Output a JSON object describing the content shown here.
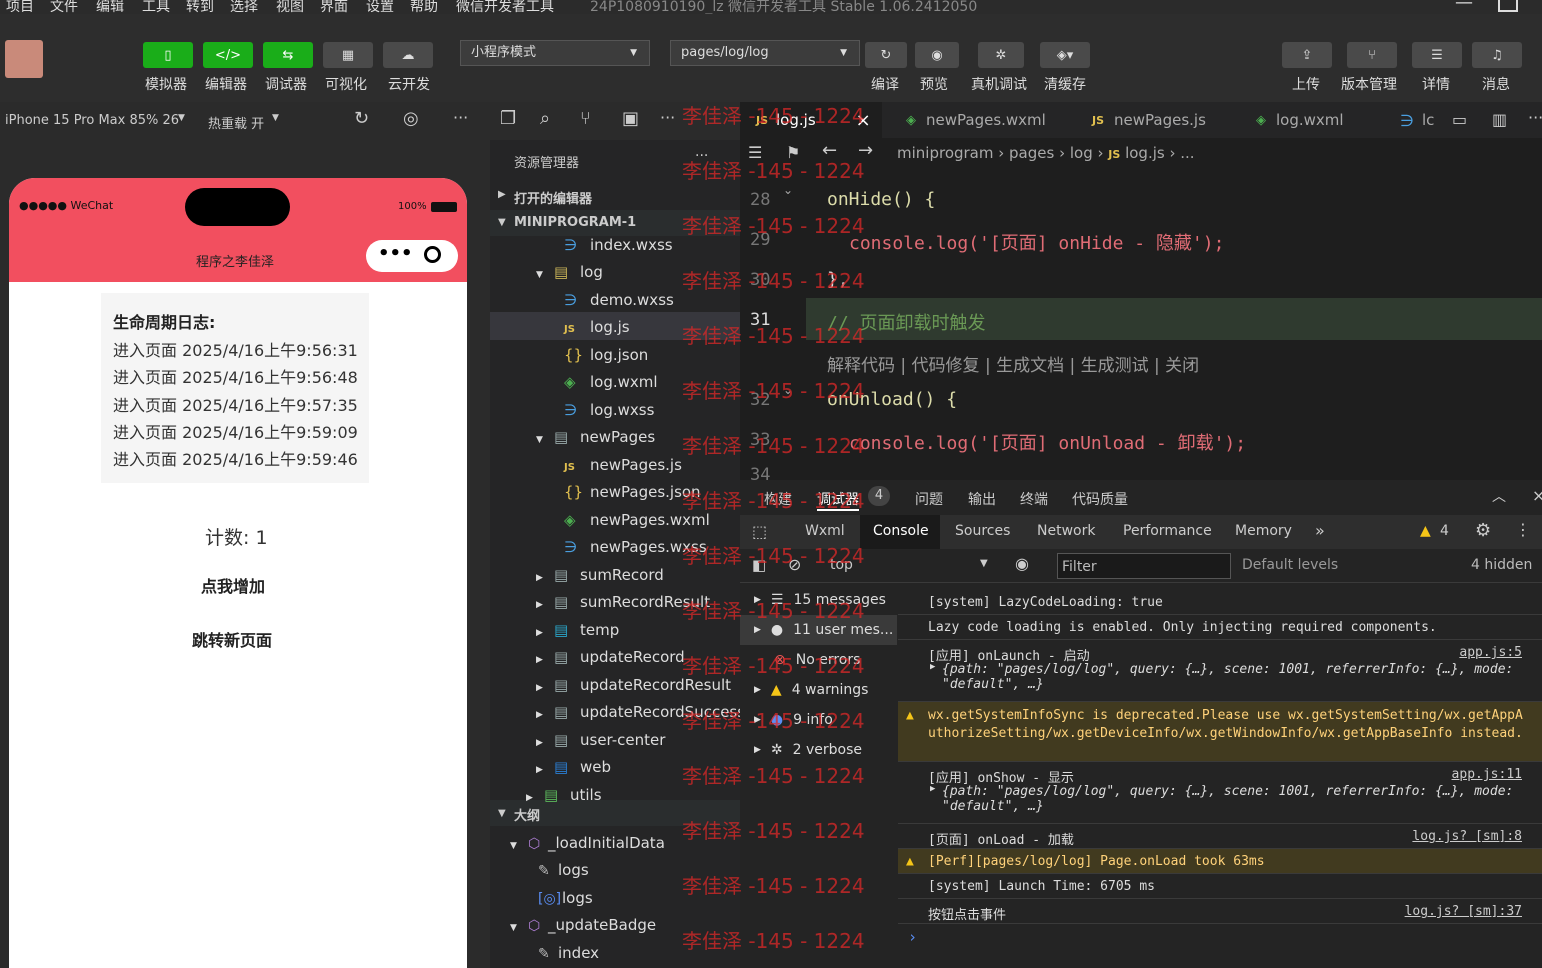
{
  "menu": [
    "项目",
    "文件",
    "编辑",
    "工具",
    "转到",
    "选择",
    "视图",
    "界面",
    "设置",
    "帮助",
    "微信开发者工具"
  ],
  "window_title": "24P1080910190_lz 微信开发者工具 Stable 1.06.2412050",
  "toolbar": {
    "simulator": "模拟器",
    "editor": "编辑器",
    "debugger": "调试器",
    "visual": "可视化",
    "cloud": "云开发",
    "mode": "小程序模式",
    "page_path": "pages/log/log",
    "compile": "编译",
    "preview": "预览",
    "real_debug": "真机调试",
    "clear_cache": "清缓存",
    "upload": "上传",
    "version": "版本管理",
    "details": "详情",
    "messages": "消息"
  },
  "subbar": {
    "device": "iPhone 15 Pro Max 85% 26",
    "hot_reload": "热重载 开"
  },
  "phone": {
    "carrier": "●●●●● WeChat",
    "battery": "100%",
    "title": "程序之李佳泽",
    "log_title": "生命周期日志:",
    "logs": [
      "进入页面 2025/4/16上午9:56:31",
      "进入页面 2025/4/16上午9:56:48",
      "进入页面 2025/4/16上午9:57:35",
      "进入页面 2025/4/16上午9:59:09",
      "进入页面 2025/4/16上午9:59:46"
    ],
    "count": "计数: 1",
    "add_btn": "点我增加",
    "nav_btn": "跳转新页面"
  },
  "explorer": {
    "title": "资源管理器",
    "open_editors": "打开的编辑器",
    "project": "MINIPROGRAM-1",
    "items": [
      "index.wxss",
      "log",
      "demo.wxss",
      "log.js",
      "log.json",
      "log.wxml",
      "log.wxss",
      "newPages",
      "newPages.js",
      "newPages.json",
      "newPages.wxml",
      "newPages.wxss",
      "sumRecord",
      "sumRecordResult",
      "temp",
      "updateRecord",
      "updateRecordResult",
      "updateRecordSuccess",
      "user-center",
      "web",
      "utils"
    ],
    "outline": "大纲",
    "outline_items": [
      "_loadInitialData",
      "logs",
      "logs",
      "_updateBadge",
      "index"
    ]
  },
  "tabs": [
    "log.js",
    "newPages.wxml",
    "newPages.js",
    "log.wxml",
    "lc"
  ],
  "breadcrumb": [
    "miniprogram",
    "pages",
    "log",
    "log.js",
    "..."
  ],
  "code": {
    "line_numbers": [
      "28",
      "29",
      "30",
      "31",
      "32",
      "33",
      "34"
    ],
    "l28": "onHide() {",
    "l29": "console.log('[页面] onHide - 隐藏');",
    "l30": "},",
    "l31": "// 页面卸载时触发",
    "actions": "解释代码 | 代码修复 | 生成文档 | 生成测试 | 关闭",
    "l32": "onUnload() {",
    "l33": "console.log('[页面] onUnload - 卸载');"
  },
  "devtools": {
    "top_tabs": [
      "构建",
      "调试器",
      "问题",
      "输出",
      "终端",
      "代码质量"
    ],
    "debugger_badge": "4",
    "panel_tabs": [
      "Wxml",
      "Console",
      "Sources",
      "Network",
      "Performance",
      "Memory"
    ],
    "warn_count": "4",
    "context": "top",
    "filter_placeholder": "Filter",
    "levels": "Default levels",
    "hidden": "4 hidden",
    "sidebar": [
      "15 messages",
      "11 user mes...",
      "No errors",
      "4 warnings",
      "9 info",
      "2 verbose"
    ]
  },
  "console": [
    {
      "text": "[system] LazyCodeLoading: true"
    },
    {
      "text": "Lazy code loading is enabled. Only injecting required components."
    },
    {
      "text": "[应用] onLaunch - 启动",
      "link": "app.js:5",
      "sub": "{path: \"pages/log/log\", query: {…}, scene: 1001, referrerInfo: {…}, mode: \"default\", …}"
    },
    {
      "text": "wx.getSystemInfoSync is deprecated.Please use wx.getSystemSetting/wx.getAppAuthorizeSetting/wx.getDeviceInfo/wx.getWindowInfo/wx.getAppBaseInfo instead.",
      "warn": true
    },
    {
      "text": "[应用] onShow - 显示",
      "link": "app.js:11",
      "sub": "{path: \"pages/log/log\", query: {…}, scene: 1001, referrerInfo: {…}, mode: \"default\", …}"
    },
    {
      "text": "[页面] onLoad - 加载",
      "link": "log.js? [sm]:8"
    },
    {
      "text": "[Perf][pages/log/log] Page.onLoad took 63ms",
      "warn": true
    },
    {
      "text": "[system] Launch Time: 6705 ms"
    },
    {
      "text": "按钮点击事件",
      "link": "log.js? [sm]:37"
    }
  ],
  "watermark": "李佳泽 -145 - 1224"
}
